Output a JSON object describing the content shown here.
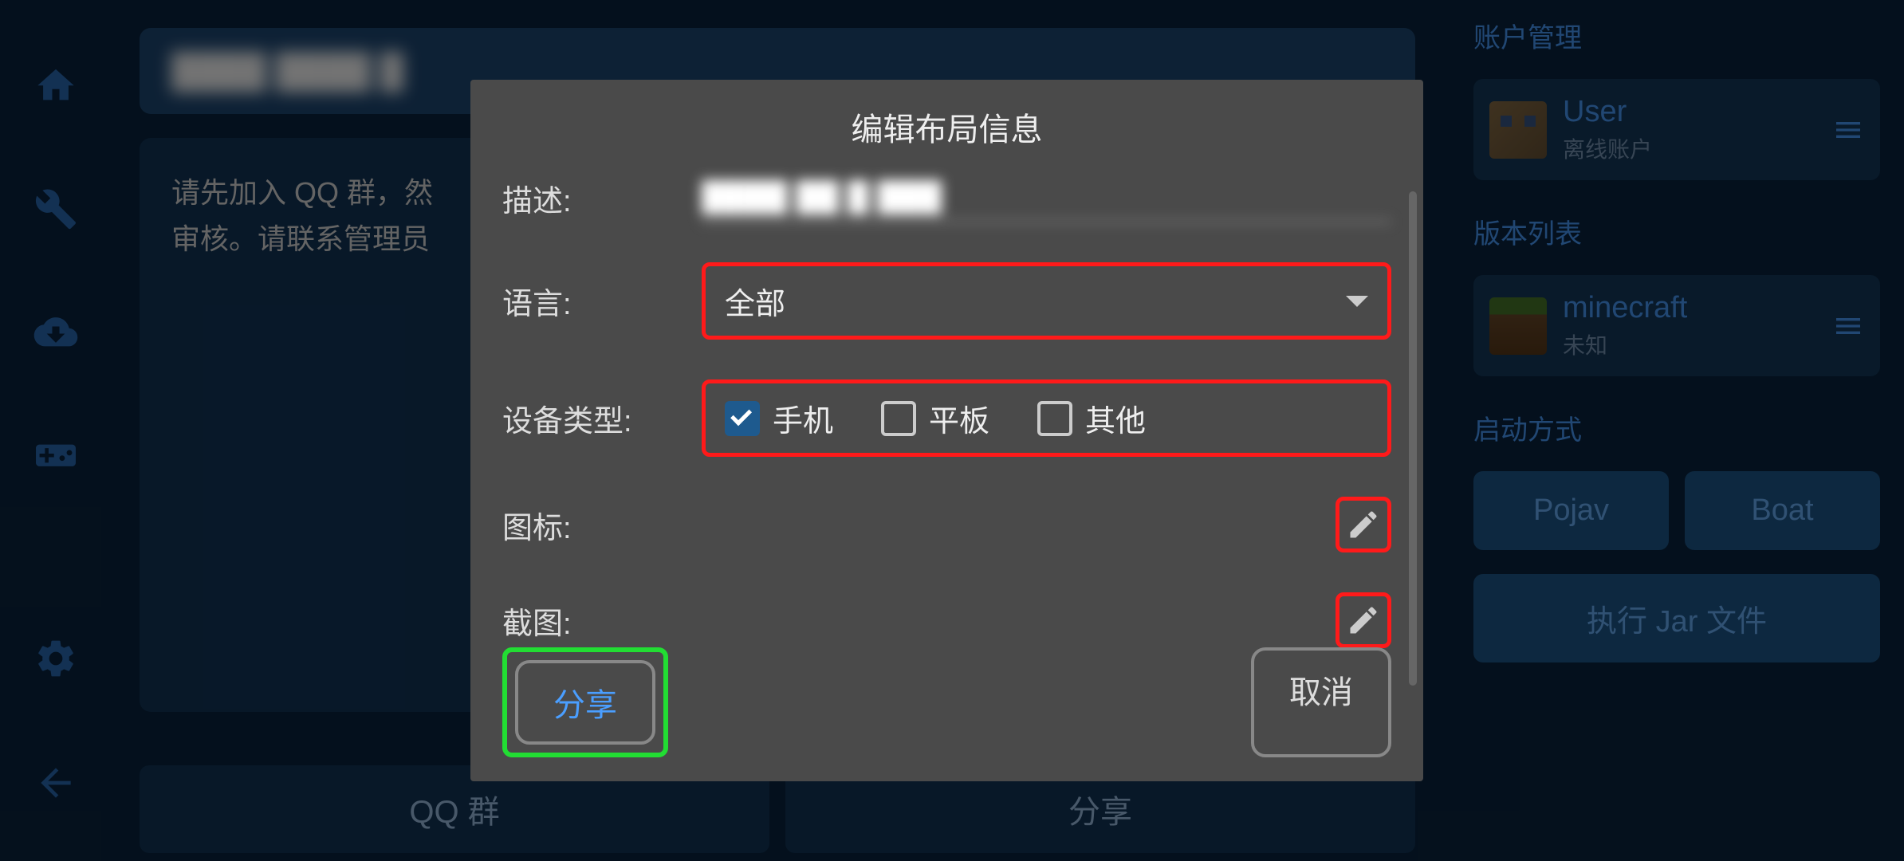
{
  "nav": {
    "home": "home",
    "tools": "tools",
    "download": "download",
    "controller": "controller",
    "settings": "settings",
    "back": "back"
  },
  "main": {
    "info_text_1": "请先加入 QQ 群，然",
    "info_text_2": "审核。请联系管理员"
  },
  "bottom_tabs": {
    "qq": "QQ 群",
    "share": "分享"
  },
  "right": {
    "account_heading": "账户管理",
    "user_name": "User",
    "user_sub": "离线账户",
    "version_heading": "版本列表",
    "version_name": "minecraft",
    "version_sub": "未知",
    "launch_heading": "启动方式",
    "pojav": "Pojav",
    "boat": "Boat",
    "jar": "执行 Jar 文件"
  },
  "modal": {
    "title": "编辑布局信息",
    "desc_label": "描述:",
    "lang_label": "语言:",
    "lang_value": "全部",
    "device_label": "设备类型:",
    "device_phone": "手机",
    "device_tablet": "平板",
    "device_other": "其他",
    "icon_label": "图标:",
    "screenshot_label": "截图:",
    "share_btn": "分享",
    "cancel_btn": "取消"
  }
}
